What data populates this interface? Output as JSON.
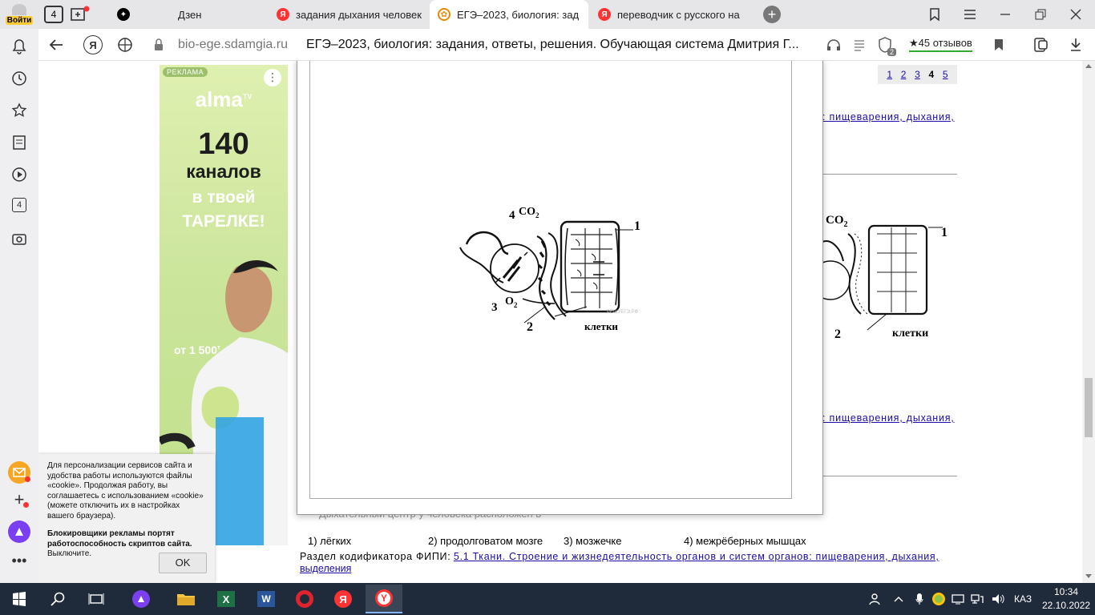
{
  "tabs": {
    "login_label": "Войти",
    "tab_count": "4",
    "dzen": "Дзен",
    "tab1": "задания дыхания человек",
    "tab2": "ЕГЭ–2023, биология: зад",
    "tab3": "переводчик с русского на"
  },
  "toolbar": {
    "domain": "bio-ege.sdamgia.ru",
    "page_title": "ЕГЭ–2023, биология: задания, ответы, решения. Обучающая система Дмитрия Г...",
    "reviews": "★45 отзывов",
    "badge": "2"
  },
  "sidebar": {
    "badge4": "4"
  },
  "ad": {
    "label": "РЕКЛАМА",
    "brand": "alma",
    "brand_sup": "TV",
    "line1": "140",
    "line2": "каналов",
    "line3": "в твоей",
    "line4": "ТАРЕЛКЕ!",
    "price": "от 1 500",
    "price_sup": "т"
  },
  "cookie": {
    "text": "Для персонализации сервисов сайта и удобства работы используются файлы «cookie». Продолжая работу, вы соглашаетесь с использованием «cookie» (можете отключить их в настройках вашего браузера).",
    "bold": "Блокировщики рекламы портят работоспособность скриптов сайта.",
    "tail": " Выключите.",
    "ok": "OK"
  },
  "pager": [
    "1",
    "2",
    "3",
    "4",
    "5"
  ],
  "pager_current": "4",
  "page": {
    "codifier_tail": ": пищеварения, дыхания,",
    "hidden_question": "Дыхательный центр у человека расположен в",
    "opt1": "1) лёгких",
    "opt2": "2) продолговатом мозге",
    "opt3": "3) мозжечке",
    "opt4": "4) межрёберных мышцах",
    "codifier_label": "Раздел кодификатора ФИПИ:",
    "codifier_link": "5.1 Ткани. Строение и жизнедеятельность органов и систем органов: пищеварения, дыхания,",
    "codifier_link2": "выделения"
  },
  "figure": {
    "n1": "1",
    "n2": "2",
    "n3": "3",
    "n4": "4",
    "co2": "CO",
    "co2sub": "2",
    "o2": "O",
    "o2sub": "2",
    "cells": "клетки",
    "wm": "РЕШУЕГЭ.РФ"
  },
  "taskbar": {
    "lang": "КАЗ",
    "time": "10:34",
    "date": "22.10.2022"
  }
}
